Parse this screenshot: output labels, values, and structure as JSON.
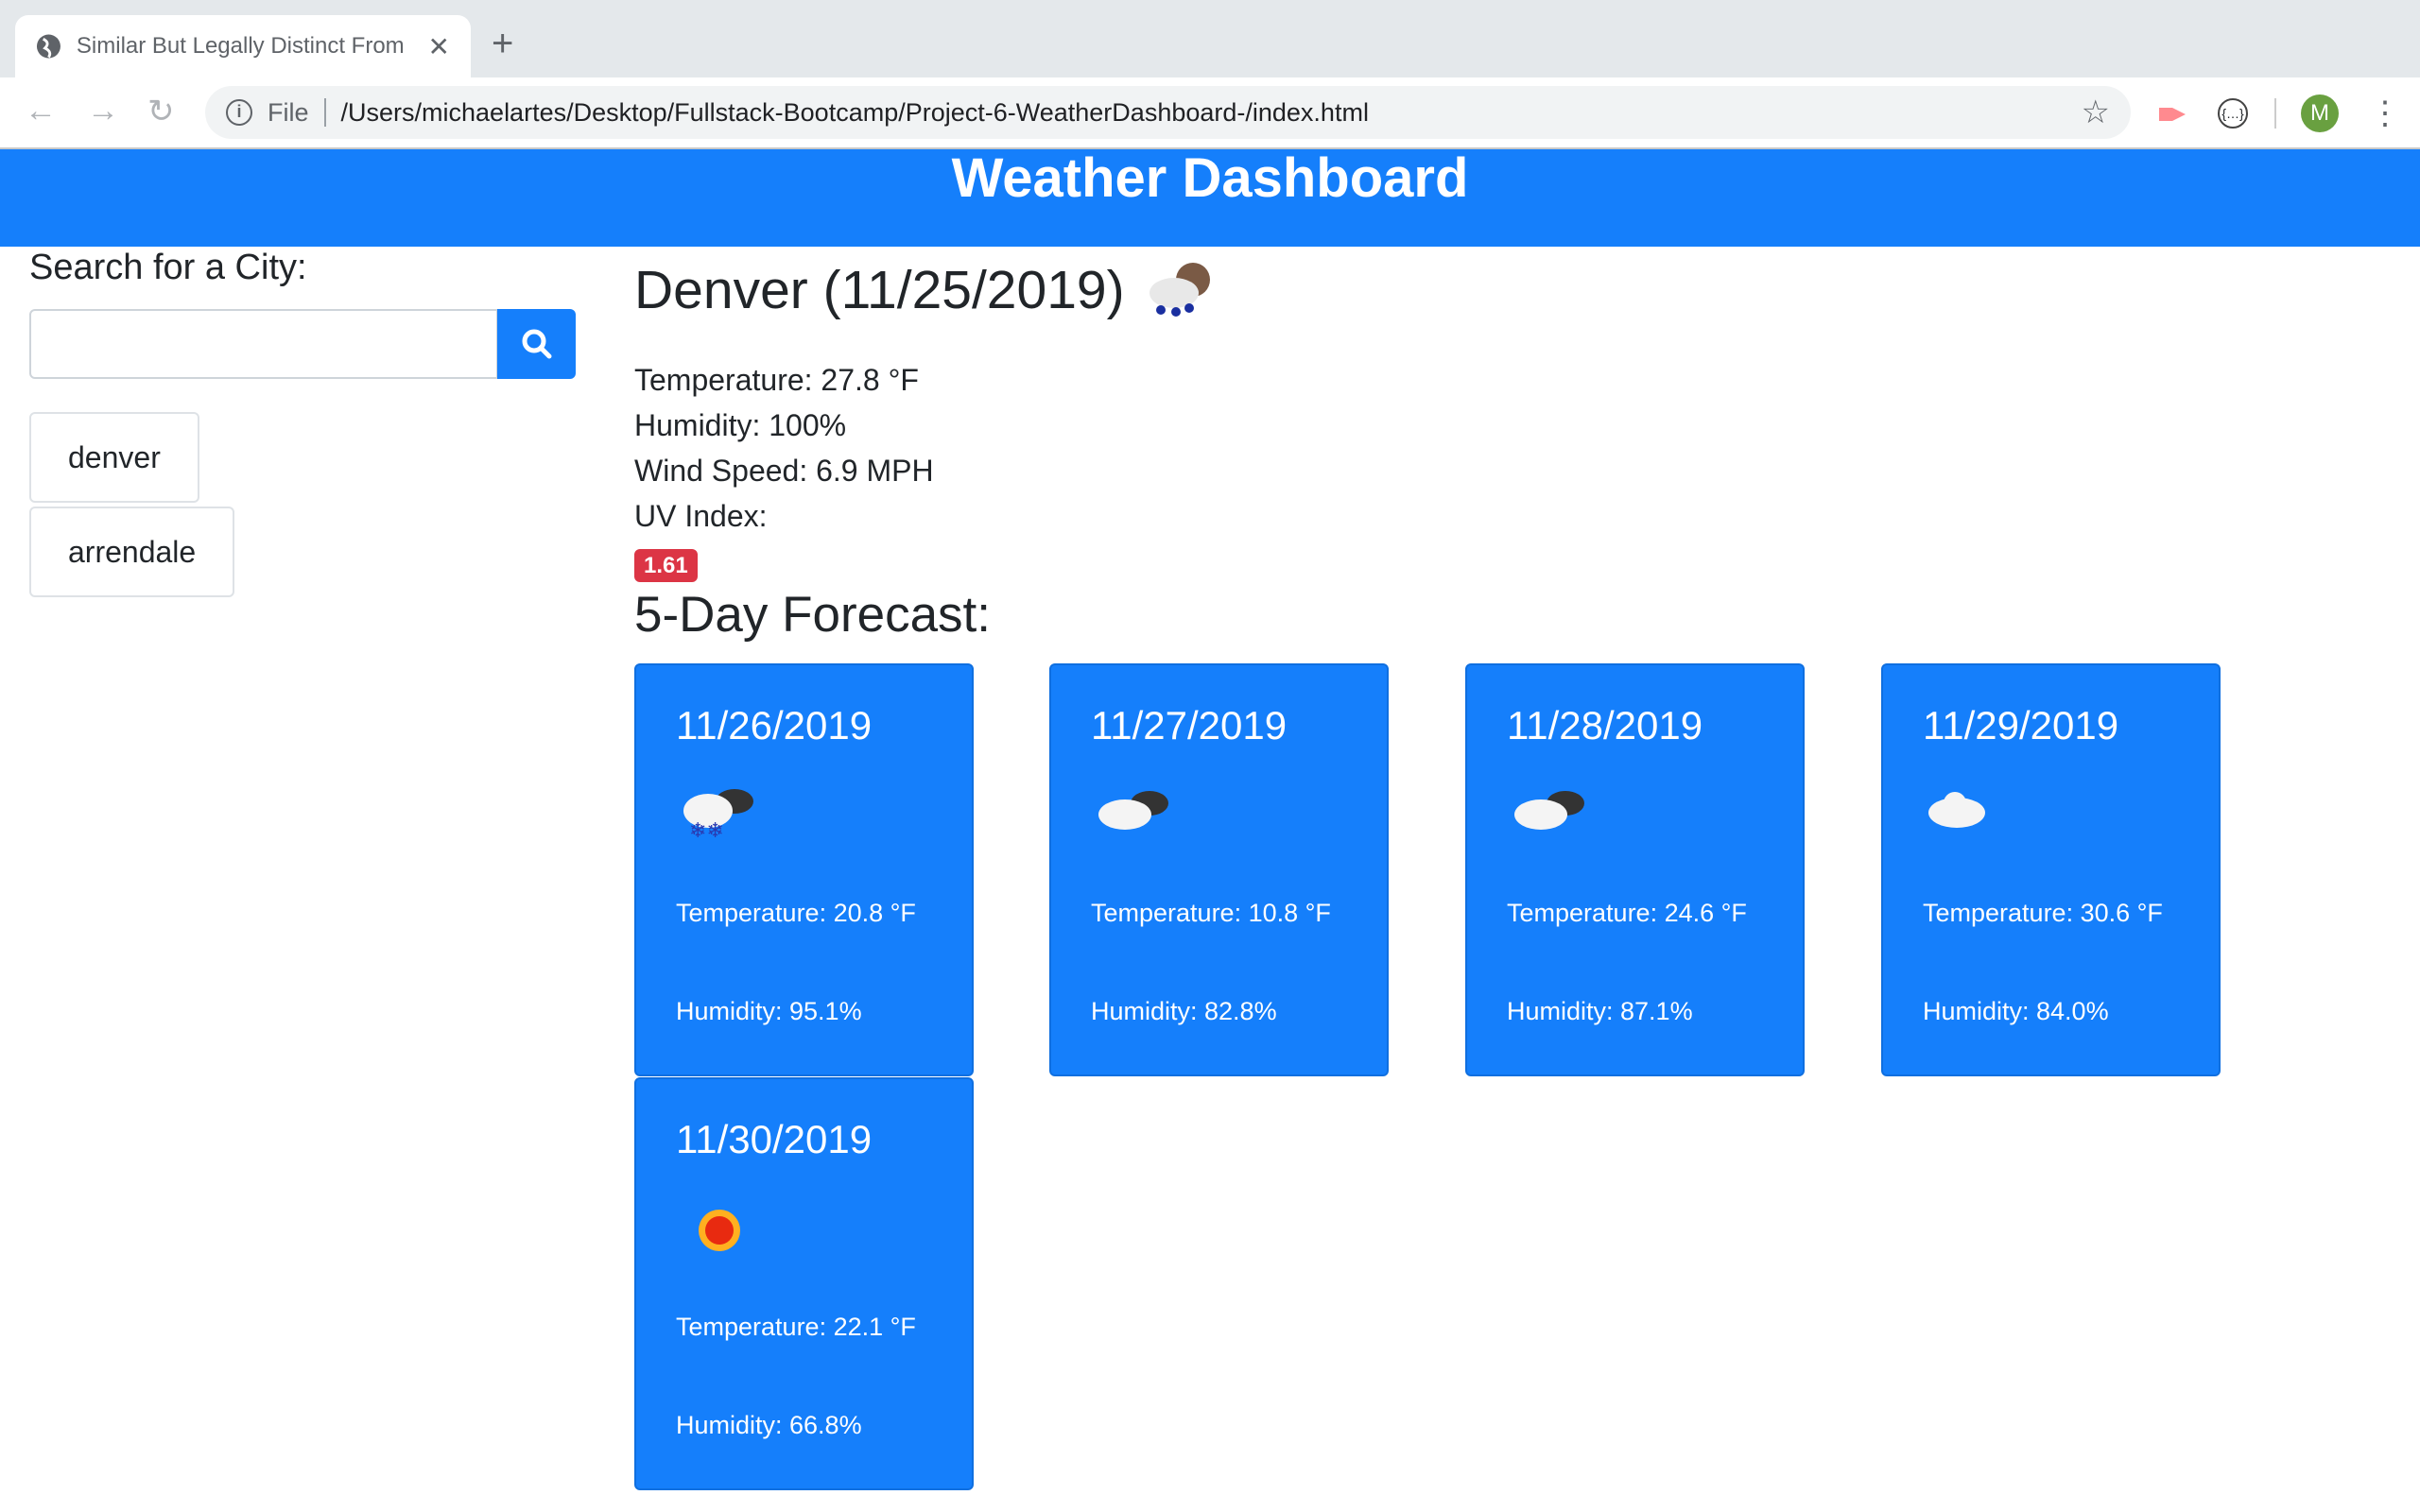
{
  "browser": {
    "tab_title": "Similar But Legally Distinct From",
    "url_scheme": "File",
    "url": "/Users/michaelartes/Desktop/Fullstack-Bootcamp/Project-6-WeatherDashboard-/index.html",
    "avatar_initial": "M"
  },
  "header": {
    "title": "Weather Dashboard"
  },
  "sidebar": {
    "search_label": "Search for a City:",
    "search_value": "",
    "history": [
      {
        "label": "denver"
      },
      {
        "label": "arrendale"
      }
    ]
  },
  "current": {
    "title": "Denver (11/25/2019)",
    "icon": "rain-cloud-icon",
    "temperature": "Temperature: 27.8 °F",
    "humidity": "Humidity: 100%",
    "wind": "Wind Speed: 6.9 MPH",
    "uv_label": "UV Index:",
    "uv_value": "1.61",
    "uv_color": "#dc3545"
  },
  "forecast": {
    "title": "5-Day Forecast:",
    "accent": "#157ffb",
    "days": [
      {
        "date": "11/26/2019",
        "icon": "snow-cloud-icon",
        "temp": "Temperature: 20.8 °F",
        "humidity": "Humidity: 95.1%"
      },
      {
        "date": "11/27/2019",
        "icon": "broken-clouds-icon",
        "temp": "Temperature: 10.8 °F",
        "humidity": "Humidity: 82.8%"
      },
      {
        "date": "11/28/2019",
        "icon": "broken-clouds-icon",
        "temp": "Temperature: 24.6 °F",
        "humidity": "Humidity: 87.1%"
      },
      {
        "date": "11/29/2019",
        "icon": "cloud-icon",
        "temp": "Temperature: 30.6 °F",
        "humidity": "Humidity: 84.0%"
      },
      {
        "date": "11/30/2019",
        "icon": "sun-icon",
        "temp": "Temperature: 22.1 °F",
        "humidity": "Humidity: 66.8%"
      }
    ]
  }
}
